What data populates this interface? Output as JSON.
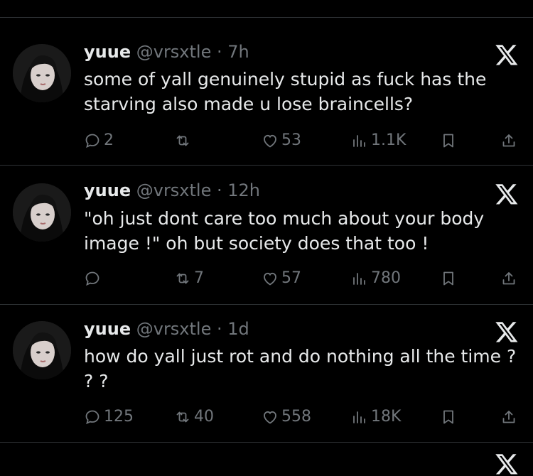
{
  "tweets": [
    {
      "name": "yuue",
      "handle": "@vrsxtle",
      "time": "7h",
      "text_line1": "some of yall genuinely stupid as fuck has the",
      "text_line2": "starving also made u lose braincells?",
      "replies": "2",
      "retweets": "",
      "likes": "53",
      "views": "1.1K"
    },
    {
      "name": "yuue",
      "handle": "@vrsxtle",
      "time": "12h",
      "text_line1": "\"oh just dont care too much about your body",
      "text_line2": "image !\" oh but society does that too !",
      "replies": "",
      "retweets": "7",
      "likes": "57",
      "views": "780"
    },
    {
      "name": "yuue",
      "handle": "@vrsxtle",
      "time": "1d",
      "text_line1": "how do yall just rot and do nothing all the time ?",
      "text_line2": "? ?",
      "replies": "125",
      "retweets": "40",
      "likes": "558",
      "views": "18K"
    }
  ],
  "separator": " · ",
  "icons": {
    "brand": "x-logo-icon",
    "reply": "reply-icon",
    "retweet": "retweet-icon",
    "like": "heart-icon",
    "views": "views-icon",
    "bookmark": "bookmark-icon",
    "share": "share-icon"
  },
  "colors": {
    "background": "#000000",
    "text": "#e7e9ea",
    "muted": "#71767b",
    "divider": "#2f3336"
  }
}
